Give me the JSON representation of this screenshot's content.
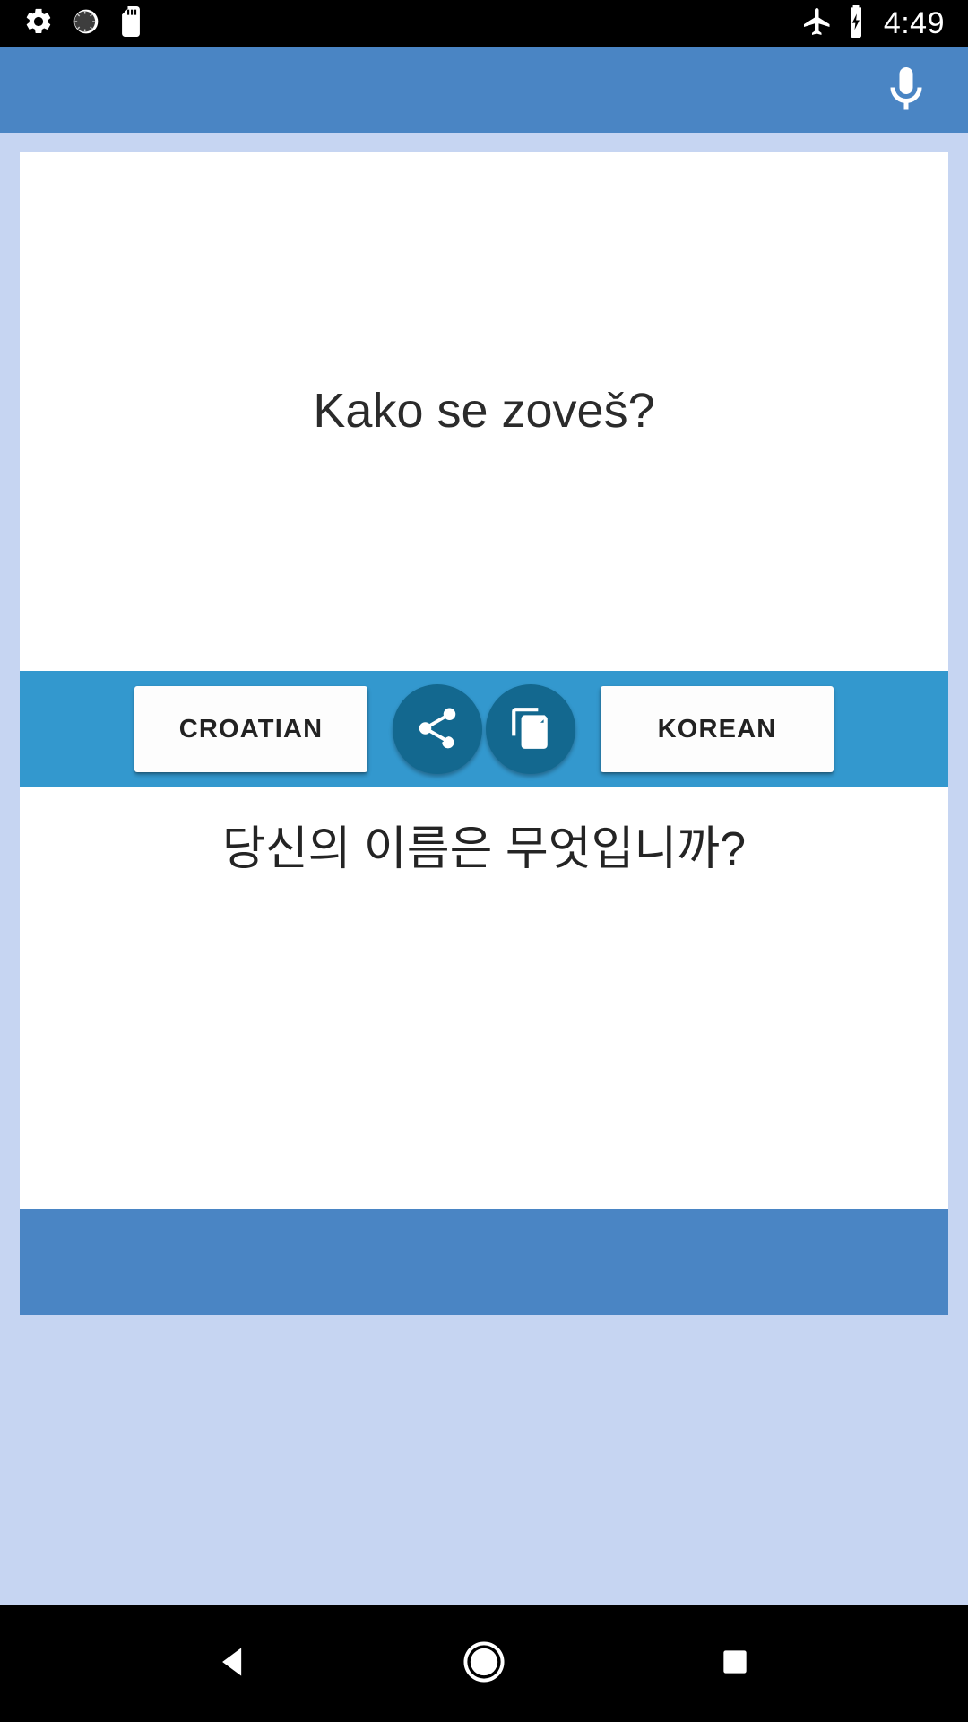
{
  "status_bar": {
    "icons_left": [
      "gear-icon",
      "circular-progress-icon",
      "sd-card-icon"
    ],
    "icons_right": [
      "airplane-mode-icon",
      "battery-charging-icon"
    ],
    "time": "4:49"
  },
  "app_bar": {
    "mic_icon": "microphone-icon",
    "background_color": "#4a85c4"
  },
  "translator": {
    "source_text": "Kako se zoveš?",
    "target_text": "당신의 이름은 무엇입니까?",
    "source_language": "CROATIAN",
    "target_language": "KOREAN",
    "share_icon": "share-icon",
    "copy_icon": "copy-icon",
    "lang_bar_color": "#3398ce",
    "round_button_color": "#13688f"
  },
  "nav_bar": {
    "back_label": "back-button",
    "home_label": "home-button",
    "recents_label": "recents-button"
  }
}
